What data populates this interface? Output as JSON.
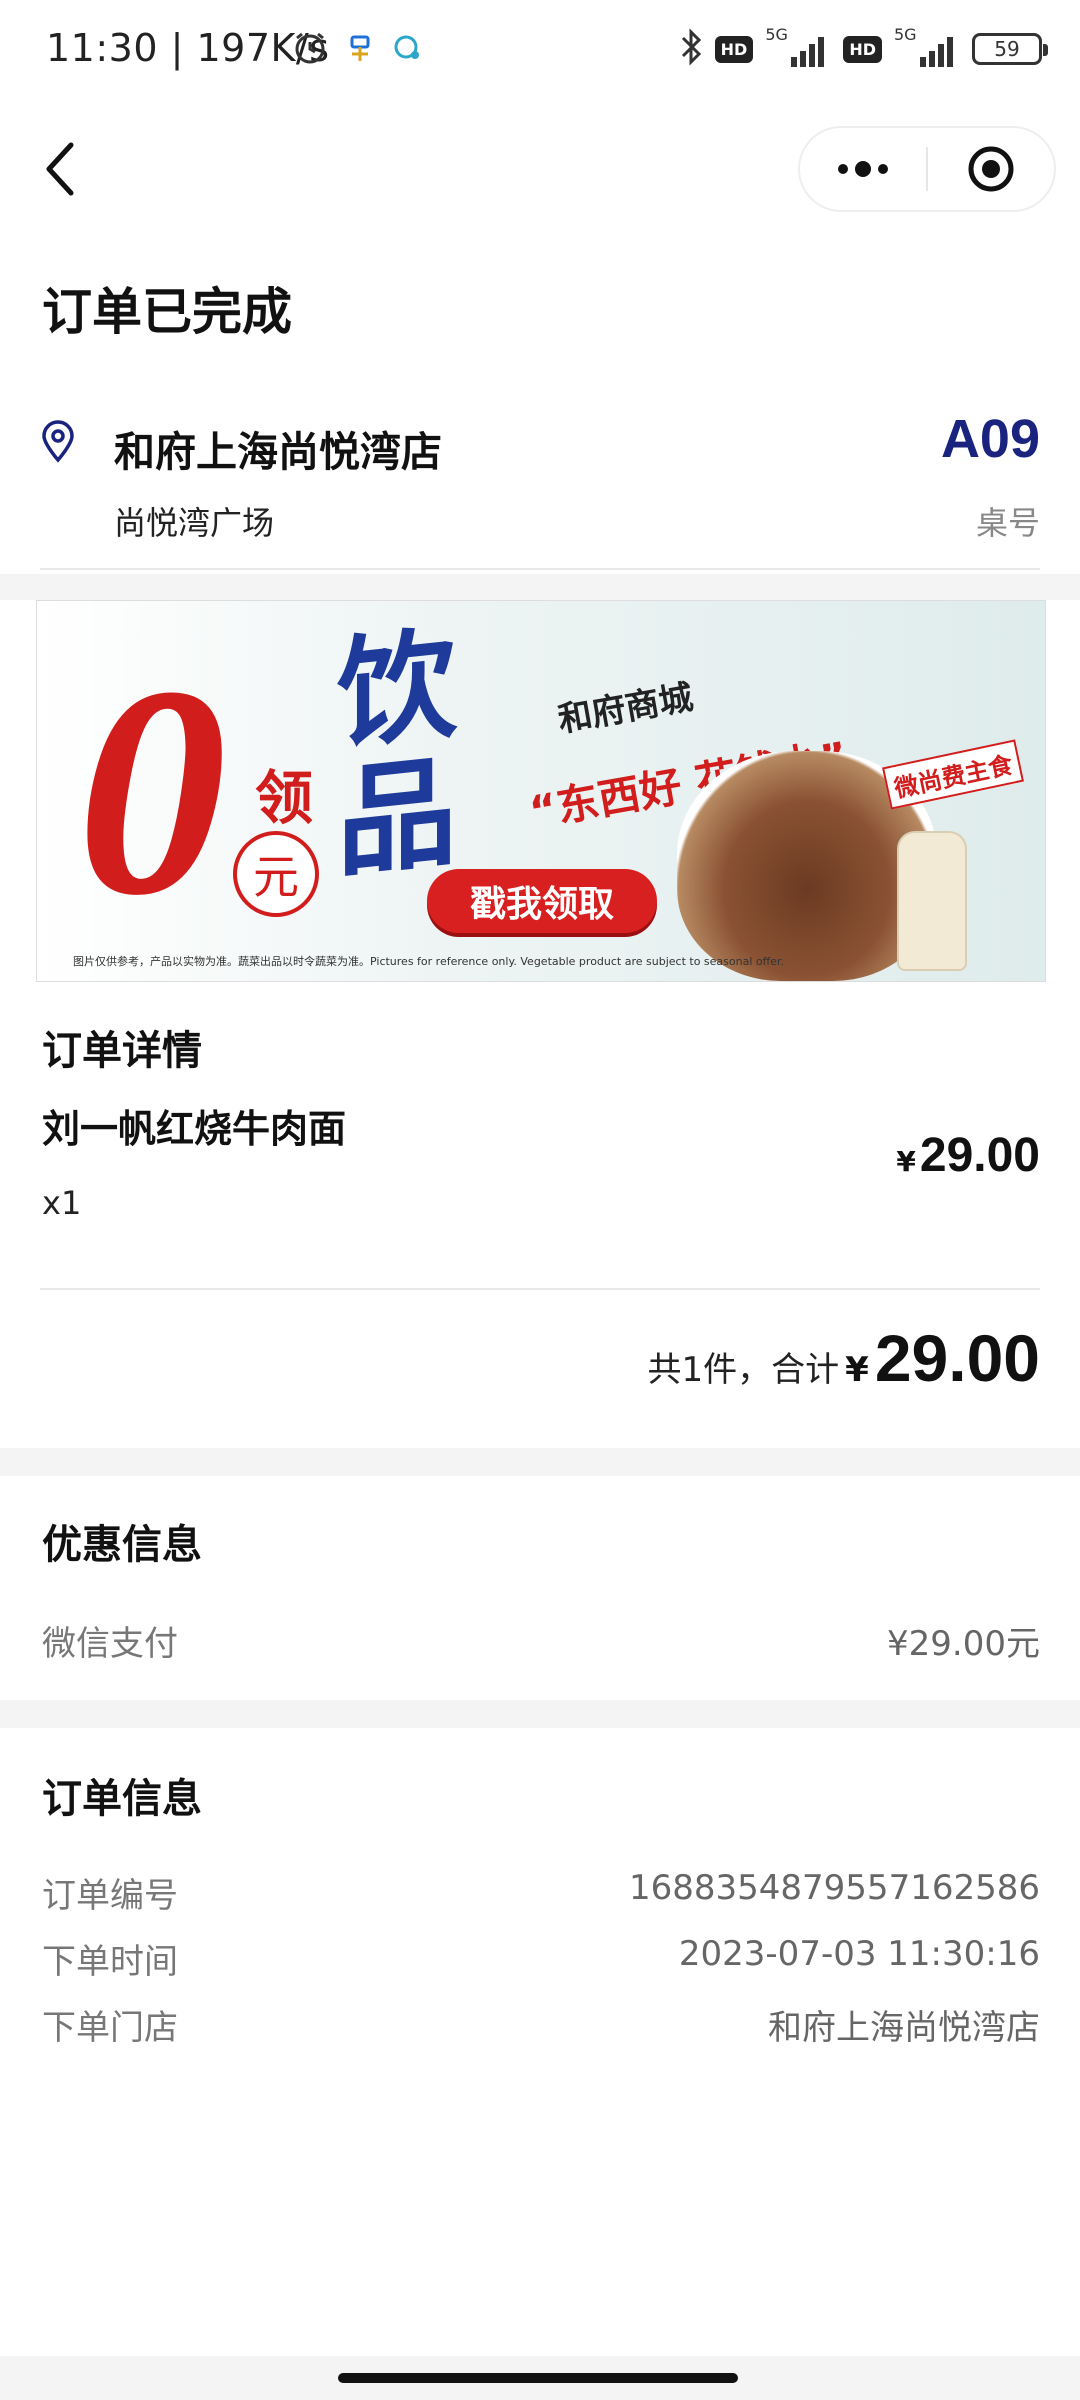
{
  "status_bar": {
    "time": "11:30",
    "speed": "197K/s",
    "battery": "59",
    "network_1": "5G",
    "network_2": "5G",
    "hd_label": "HD"
  },
  "header": {
    "title": "订单已完成"
  },
  "store": {
    "name": "和府上海尚悦湾店",
    "address": "尚悦湾广场",
    "table_number": "A09",
    "table_label": "桌号"
  },
  "banner": {
    "zero": "0",
    "ling": "领",
    "yuan": "元",
    "yin": "饮",
    "pin": "品",
    "mall": "和府商城",
    "slogan": "“东西好 花钱少”",
    "cta": "戳我领取",
    "tag": "微尚费主食",
    "footnote": "图片仅供参考，产品以实物为准。蔬菜出品以时令蔬菜为准。Pictures for reference only. Vegetable product are subject to seasonal offer."
  },
  "order_detail": {
    "title": "订单详情",
    "item_name": "刘一帆红烧牛肉面",
    "quantity": "x1",
    "currency": "¥",
    "price": "29.00",
    "total_label": "共1件，合计",
    "total_currency": "¥",
    "total": "29.00"
  },
  "discount": {
    "title": "优惠信息",
    "label": "微信支付",
    "value": "¥29.00元"
  },
  "order_info": {
    "title": "订单信息",
    "rows": [
      {
        "label": "订单编号",
        "value": "1688354879557162586"
      },
      {
        "label": "下单时间",
        "value": "2023-07-03 11:30:16"
      },
      {
        "label": "下单门店",
        "value": "和府上海尚悦湾店"
      }
    ]
  },
  "colors": {
    "table_number": "#1a237e",
    "banner_red": "#d21d1d",
    "banner_blue": "#1e3a9a"
  }
}
